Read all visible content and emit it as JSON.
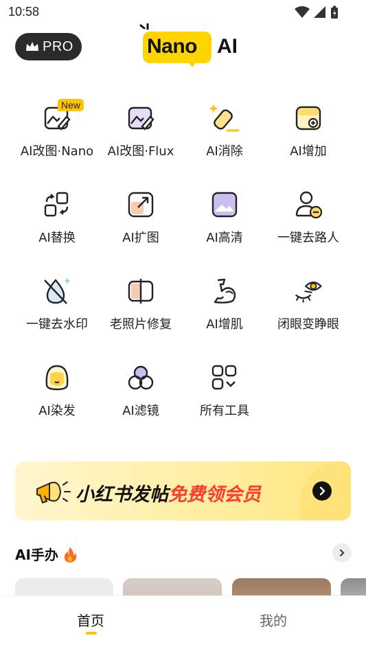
{
  "status_bar": {
    "time": "10:58"
  },
  "header": {
    "pro_label": "PRO",
    "logo_text_1": "Nano",
    "logo_text_2": "AI"
  },
  "tools": [
    {
      "label": "AI改图·Nano",
      "icon": "image-edit-icon",
      "badge": "New"
    },
    {
      "label": "AI改图·Flux",
      "icon": "image-edit-purple-icon"
    },
    {
      "label": "AI消除",
      "icon": "eraser-icon"
    },
    {
      "label": "AI增加",
      "icon": "add-image-icon"
    },
    {
      "label": "AI替换",
      "icon": "swap-icon"
    },
    {
      "label": "AI扩图",
      "icon": "expand-image-icon"
    },
    {
      "label": "AI高清",
      "icon": "hd-image-icon"
    },
    {
      "label": "一键去路人",
      "icon": "remove-person-icon"
    },
    {
      "label": "一键去水印",
      "icon": "remove-watermark-icon"
    },
    {
      "label": "老照片修复",
      "icon": "photo-restore-icon"
    },
    {
      "label": "AI增肌",
      "icon": "muscle-icon"
    },
    {
      "label": "闭眼变睁眼",
      "icon": "eye-open-icon"
    },
    {
      "label": "AI染发",
      "icon": "hair-dye-icon"
    },
    {
      "label": "AI滤镜",
      "icon": "filter-icon"
    },
    {
      "label": "所有工具",
      "icon": "all-tools-icon"
    }
  ],
  "banner": {
    "text_main": "小红书发帖",
    "text_highlight": "免费领会员"
  },
  "section": {
    "title": "AI手办"
  },
  "bottom_nav": {
    "home": "首页",
    "mine": "我的"
  },
  "colors": {
    "accent": "#ffc400",
    "brand_yellow": "#ffd400",
    "highlight_red": "#ff3b2f",
    "icon_purple": "#b9a7ee"
  }
}
